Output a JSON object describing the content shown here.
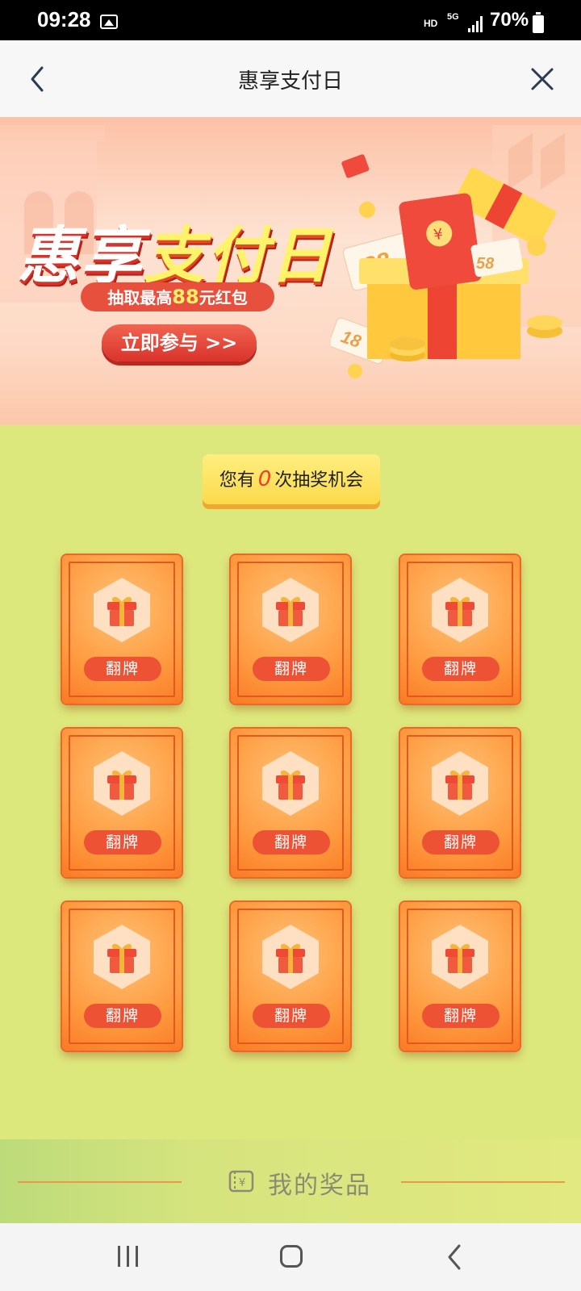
{
  "status_bar": {
    "time": "09:28",
    "hd": "HD",
    "network": "5G",
    "battery": "70%"
  },
  "header": {
    "title": "惠享支付日"
  },
  "banner": {
    "title_part1": "惠享",
    "title_part2": "支付日",
    "subtitle_prefix": "抽取最高",
    "subtitle_amount": "88",
    "subtitle_suffix": "元红包",
    "cta": "立即参与 >>"
  },
  "chances": {
    "prefix": "您有",
    "count": "0",
    "suffix": "次抽奖机会"
  },
  "cards": [
    {
      "label": "翻牌"
    },
    {
      "label": "翻牌"
    },
    {
      "label": "翻牌"
    },
    {
      "label": "翻牌"
    },
    {
      "label": "翻牌"
    },
    {
      "label": "翻牌"
    },
    {
      "label": "翻牌"
    },
    {
      "label": "翻牌"
    },
    {
      "label": "翻牌"
    }
  ],
  "footer": {
    "my_prizes": "我的奖品"
  },
  "colors": {
    "page_bg": "#dde87c",
    "card_orange": "#ff9b40",
    "button_red": "#ec5233",
    "accent_yellow": "#fbd94b"
  }
}
